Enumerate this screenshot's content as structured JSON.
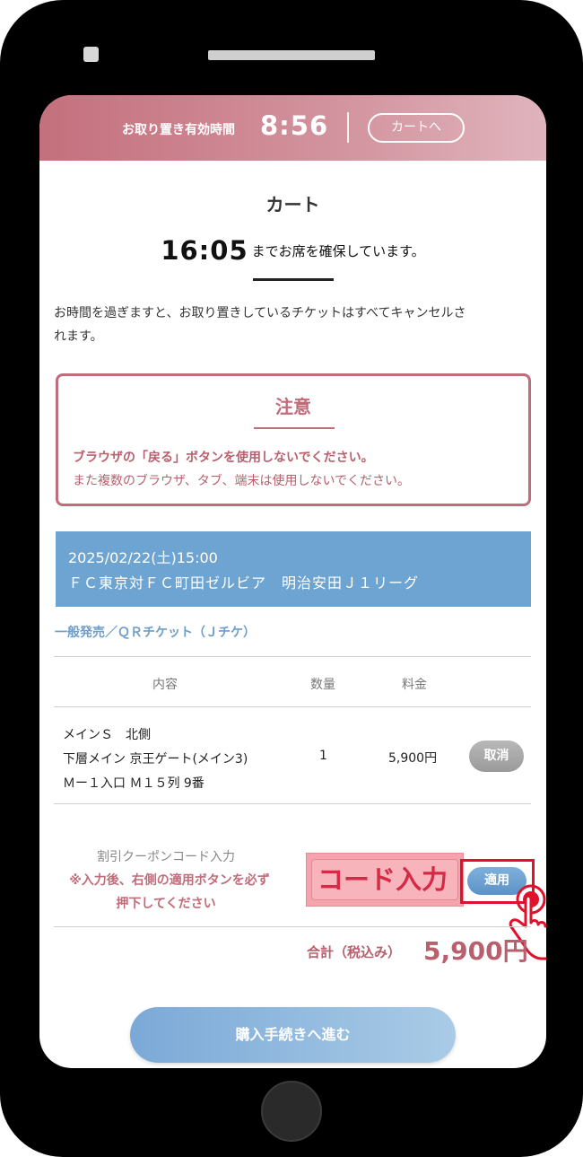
{
  "timer_bar": {
    "label": "お取り置き有効時間",
    "time": "8:56",
    "cart_link": "カートへ"
  },
  "cart": {
    "title": "カート",
    "hold_time": "16:05",
    "hold_text": "までお席を確保しています。",
    "notice_line1": "お時間を過ぎますと、お取り置きしているチケットはすべてキャンセルさ",
    "notice_line2": "れます。"
  },
  "warning": {
    "title": "注意",
    "line1": "ブラウザの「戻る」ボタンを使用しないでください。",
    "line2": "また複数のブラウザ、タブ、端末は使用しないでください。"
  },
  "event": {
    "datetime": "2025/02/22(土)15:00",
    "name": "ＦＣ東京対ＦＣ町田ゼルビア　明治安田Ｊ１リーグ"
  },
  "ticket_type": "一般発売／ＱＲチケット（Ｊチケ）",
  "table": {
    "headers": [
      "内容",
      "数量",
      "料金"
    ],
    "rows": [
      {
        "item_lines": [
          "メインＳ　北側",
          "下層メイン 京王ゲート(メイン3)",
          "Ｍー１入口 Ｍ１５列 9番"
        ],
        "qty": "1",
        "price": "5,900円",
        "cancel_label": "取消"
      }
    ]
  },
  "coupon": {
    "label": "割引クーポンコード入力",
    "note_line1": "※入力後、右側の適用ボタンを必ず",
    "note_line2": "押下してください",
    "input_placeholder": "コード入力",
    "apply_label": "適用"
  },
  "total": {
    "label": "合計（税込み）",
    "value": "5,900円"
  },
  "purchase_button": "購入手続きへ進む",
  "colors": {
    "accent_pink": "#c06c7a",
    "accent_blue": "#6ea4d2",
    "highlight_red": "#e0112d"
  }
}
